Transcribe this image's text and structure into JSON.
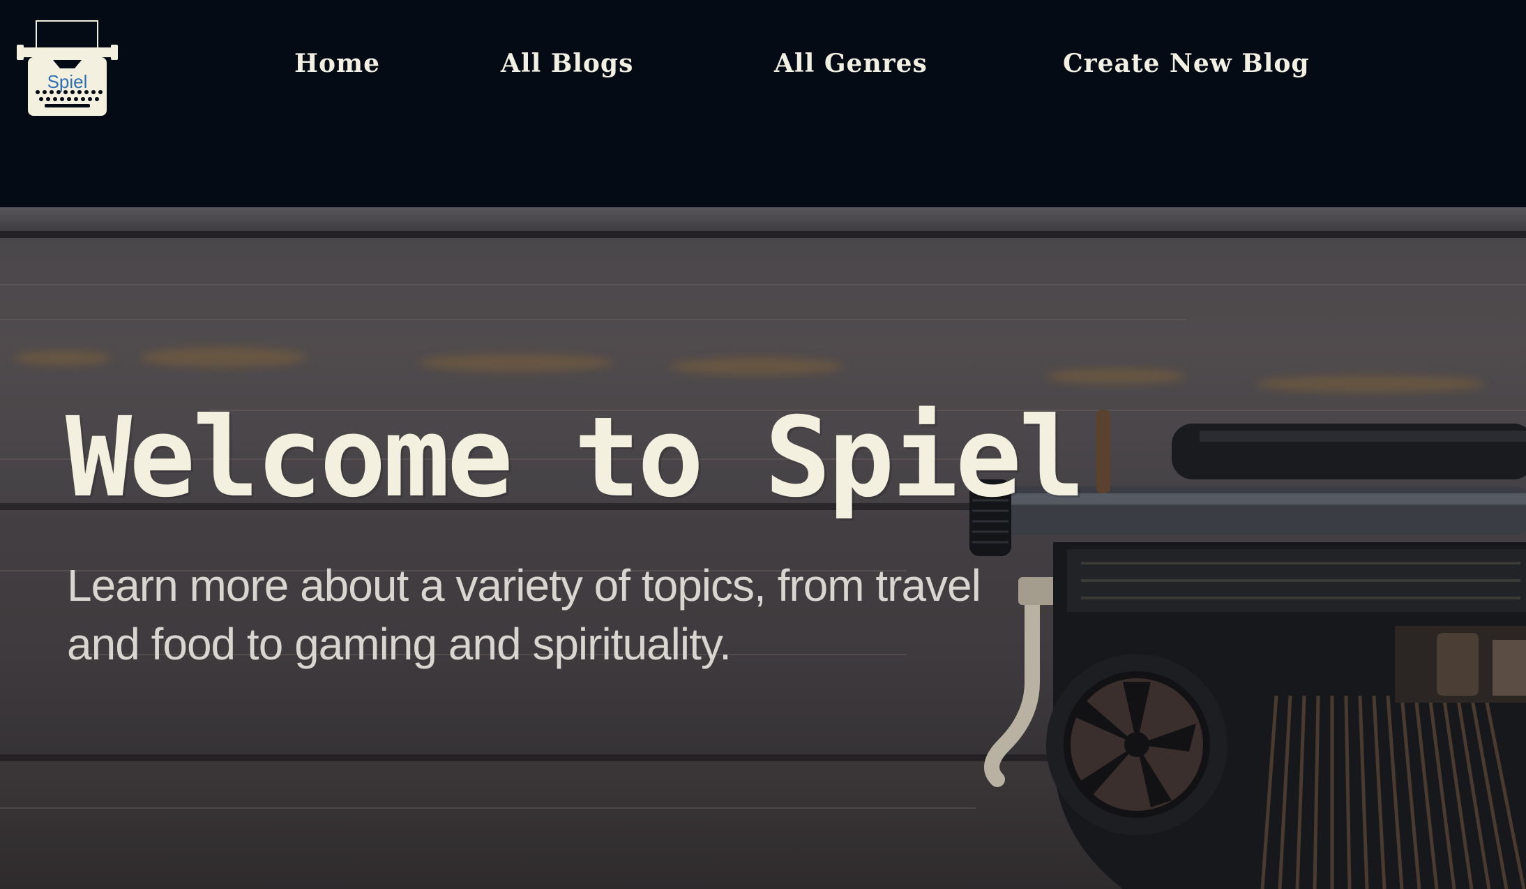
{
  "header": {
    "logo": {
      "text": "Spiel",
      "icon": "typewriter-logo-icon"
    },
    "nav": [
      {
        "label": "Home"
      },
      {
        "label": "All Blogs"
      },
      {
        "label": "All Genres"
      },
      {
        "label": "Create New Blog"
      }
    ]
  },
  "hero": {
    "title": "Welcome to Spiel",
    "subtitle": "Learn more about a variety of topics, from travel and food to gaming and spirituality.",
    "background": "wood-planks-with-typewriter"
  },
  "colors": {
    "header_bg": "#040b15",
    "nav_text": "#f2efe3",
    "title_text": "#f4f0e0",
    "subtitle_text": "#d8d6d0",
    "logo_text": "#2f6fb3"
  }
}
